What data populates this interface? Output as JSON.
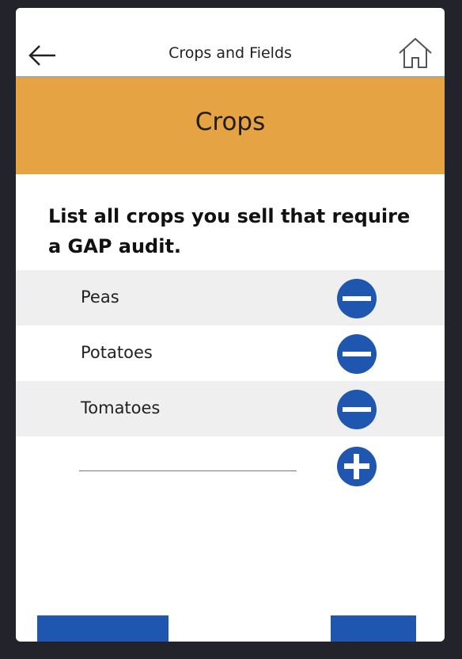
{
  "header": {
    "title": "Crops and Fields",
    "back_icon": "back-arrow-icon",
    "home_icon": "home-icon"
  },
  "banner": {
    "title": "Crops",
    "color": "#e6a344"
  },
  "prompt": "List all crops you sell that require a GAP audit.",
  "crops": [
    {
      "name": "Peas"
    },
    {
      "name": "Potatoes"
    },
    {
      "name": "Tomatoes"
    }
  ],
  "new_crop": {
    "value": "",
    "placeholder": ""
  },
  "colors": {
    "accent": "#1e56b0",
    "row_shade": "#efefef"
  },
  "icons": {
    "remove": "minus-circle-icon",
    "add": "plus-circle-icon"
  }
}
